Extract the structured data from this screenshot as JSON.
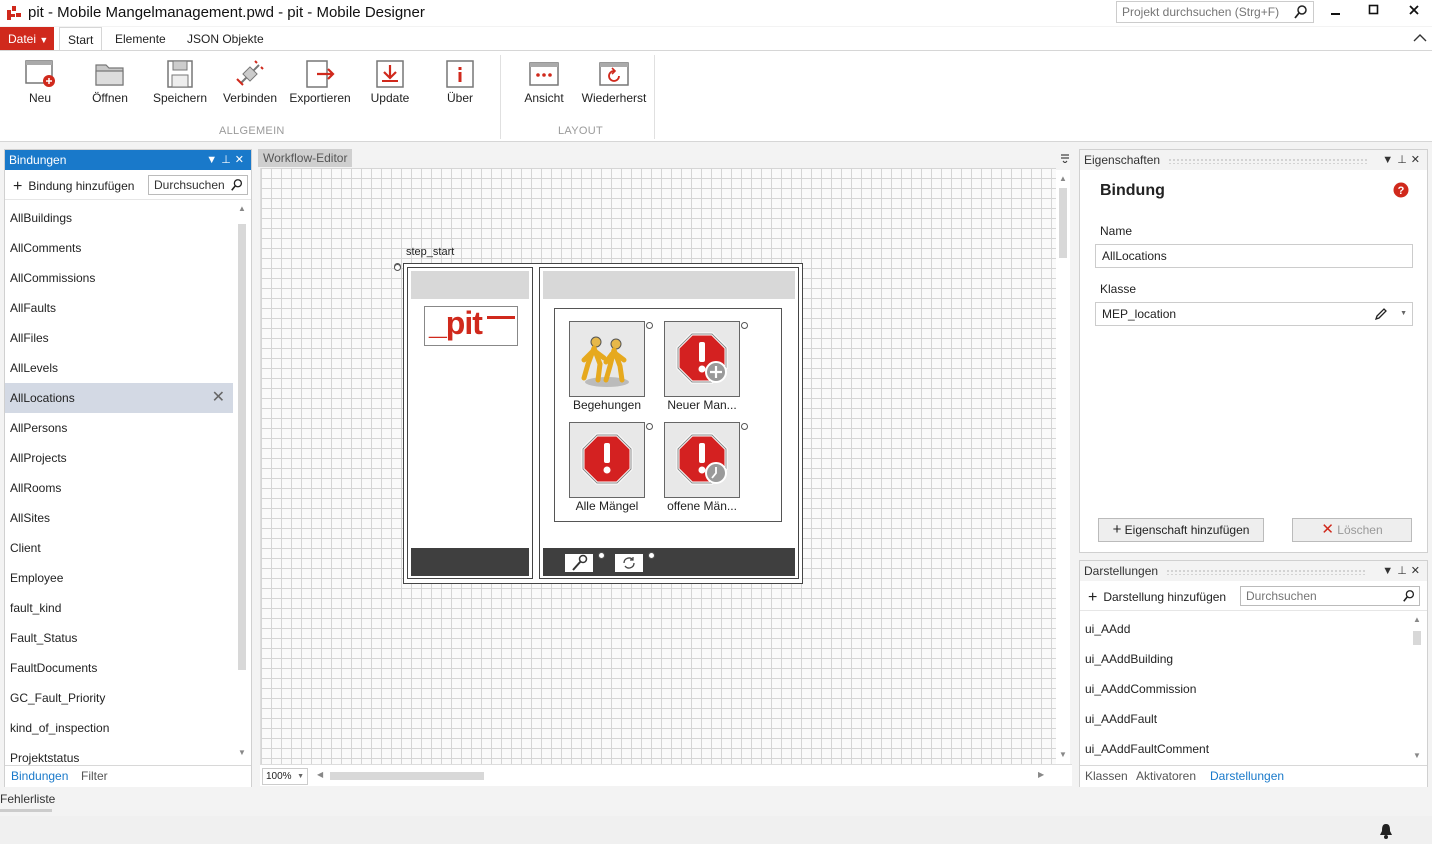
{
  "window": {
    "title": "pit - Mobile Mangelmanagement.pwd - pit - Mobile Designer",
    "search_placeholder": "Projekt durchsuchen (Strg+F)"
  },
  "ribbon": {
    "tabs": [
      "Datei",
      "Start",
      "Elemente",
      "JSON Objekte"
    ],
    "buttons": [
      "Neu",
      "Öffnen",
      "Speichern",
      "Verbinden",
      "Exportieren",
      "Update",
      "Über",
      "Ansicht",
      "Wiederherst"
    ],
    "groups": [
      "ALLGEMEIN",
      "LAYOUT"
    ]
  },
  "bindings_panel": {
    "title": "Bindungen",
    "add_label": "Bindung hinzufügen",
    "search_value": "Durchsuchen",
    "items": [
      "AllBuildings",
      "AllComments",
      "AllCommissions",
      "AllFaults",
      "AllFiles",
      "AllLevels",
      "AllLocations",
      "AllPersons",
      "AllProjects",
      "AllRooms",
      "AllSites",
      "Client",
      "Employee",
      "fault_kind",
      "Fault_Status",
      "FaultDocuments",
      "GC_Fault_Priority",
      "kind_of_inspection",
      "Projektstatus"
    ],
    "selected": "AllLocations",
    "bottom_tabs": [
      "Bindungen",
      "Filter"
    ]
  },
  "workflow": {
    "tab_label": "Workflow-Editor",
    "step_label": "step_start",
    "logo_text": "_pit",
    "tiles": [
      "Begehungen",
      "Neuer Man...",
      "Alle Mängel",
      "offene Män..."
    ],
    "zoom": "100%"
  },
  "properties_panel": {
    "title": "Eigenschaften",
    "heading": "Bindung",
    "name_label": "Name",
    "name_value": "AllLocations",
    "class_label": "Klasse",
    "class_value": "MEP_location",
    "add_property": "Eigenschaft hinzufügen",
    "delete": "Löschen"
  },
  "representations_panel": {
    "title": "Darstellungen",
    "add_label": "Darstellung hinzufügen",
    "search_placeholder": "Durchsuchen",
    "items": [
      "ui_AAdd",
      "ui_AAddBuilding",
      "ui_AAddCommission",
      "ui_AAddFault",
      "ui_AAddFaultComment"
    ],
    "bottom_tabs": [
      "Klassen",
      "Aktivatoren",
      "Darstellungen"
    ]
  },
  "error_list": "Fehlerliste",
  "colors": {
    "accent": "#1979ca",
    "brand_red": "#d0291c"
  }
}
